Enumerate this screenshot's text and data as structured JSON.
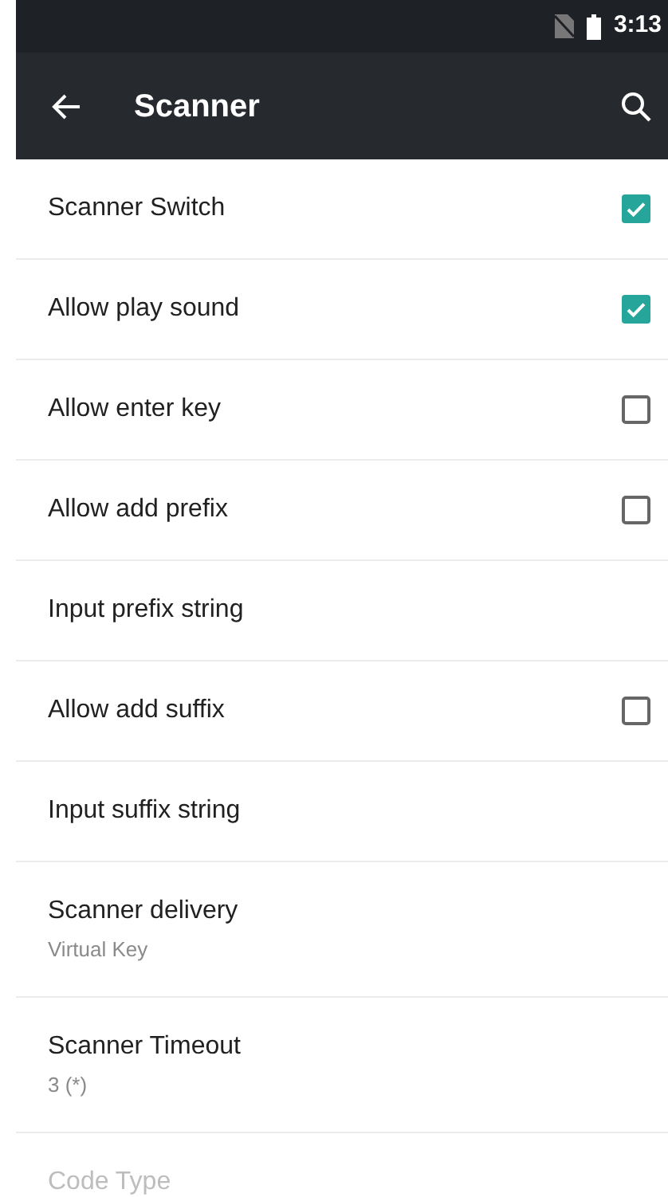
{
  "status_bar": {
    "time": "3:13"
  },
  "toolbar": {
    "title": "Scanner"
  },
  "settings": [
    {
      "kind": "checkbox",
      "title": "Scanner Switch",
      "checked": true
    },
    {
      "kind": "checkbox",
      "title": "Allow play sound",
      "checked": true
    },
    {
      "kind": "checkbox",
      "title": "Allow enter key",
      "checked": false
    },
    {
      "kind": "checkbox",
      "title": "Allow add prefix",
      "checked": false
    },
    {
      "kind": "text",
      "title": "Input prefix string"
    },
    {
      "kind": "checkbox",
      "title": "Allow add suffix",
      "checked": false
    },
    {
      "kind": "text",
      "title": "Input suffix string"
    },
    {
      "kind": "summary",
      "title": "Scanner delivery",
      "summary": "Virtual Key"
    },
    {
      "kind": "summary",
      "title": "Scanner Timeout",
      "summary": "3 (*)"
    },
    {
      "kind": "text",
      "title": "Code Type",
      "disabled": true
    }
  ]
}
